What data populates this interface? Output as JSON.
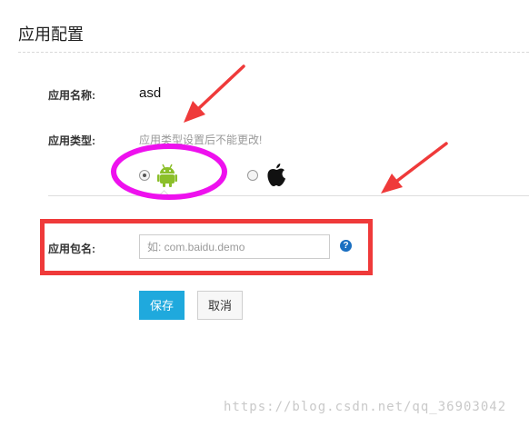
{
  "page": {
    "title": "应用配置"
  },
  "form": {
    "name": {
      "label": "应用名称:",
      "value": "asd"
    },
    "type": {
      "label": "应用类型:",
      "note": "应用类型设置后不能更改!",
      "options": [
        {
          "name": "Android",
          "icon": "android-icon",
          "checked": true
        },
        {
          "name": "iOS",
          "icon": "apple-icon",
          "checked": false
        }
      ]
    },
    "package": {
      "label": "应用包名:",
      "placeholder": "如: com.baidu.demo",
      "value": "",
      "help": "?"
    },
    "buttons": {
      "save": "保存",
      "cancel": "取消"
    }
  },
  "colors": {
    "primary": "#1fa9dd",
    "annotation_red": "#ef3a3a",
    "annotation_magenta": "#ee11ee",
    "help_blue": "#1a6fc1",
    "android_green": "#8bbf2a"
  },
  "watermark": "https://blog.csdn.net/qq_36903042"
}
